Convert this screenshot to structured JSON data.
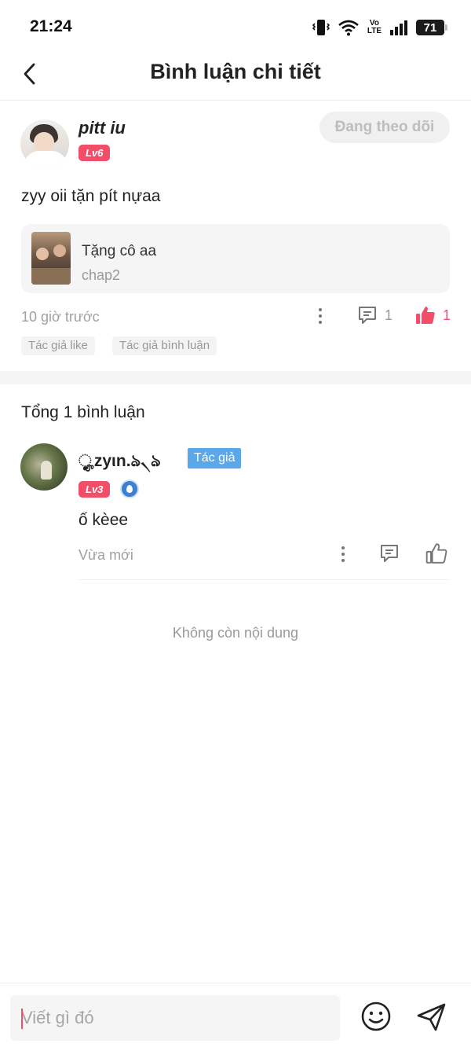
{
  "status_bar": {
    "time": "21:24",
    "volte_top": "Vo",
    "volte_bottom": "LTE",
    "battery": "71"
  },
  "header": {
    "title": "Bình luận chi tiết",
    "back_icon": "chevron-left-icon"
  },
  "post": {
    "username": "pitt iu",
    "level": "Lv6",
    "follow_label": "Đang theo dõi",
    "text": "zyy oii tặn pít nựaa",
    "reference": {
      "title": "Tặng cô aa",
      "subtitle": "chap2"
    },
    "time": "10 giờ trước",
    "comment_count": "1",
    "like_count": "1",
    "tags": [
      "Tác giả like",
      "Tác giả bình luận"
    ]
  },
  "comments": {
    "total_label": "Tổng 1 bình luận",
    "items": [
      {
        "name": "ೄ̥͙zyιn.ঌ৲ঌ",
        "author_badge": "Tác giả",
        "level": "Lv3",
        "text": "ố kèee",
        "time": "Vừa mới"
      }
    ],
    "end_label": "Không còn nội dung"
  },
  "composer": {
    "placeholder": "Viết gì đó"
  },
  "colors": {
    "accent_red": "#f24e69",
    "author_blue": "#5aa7ea",
    "muted_text": "#a0a0a0"
  }
}
